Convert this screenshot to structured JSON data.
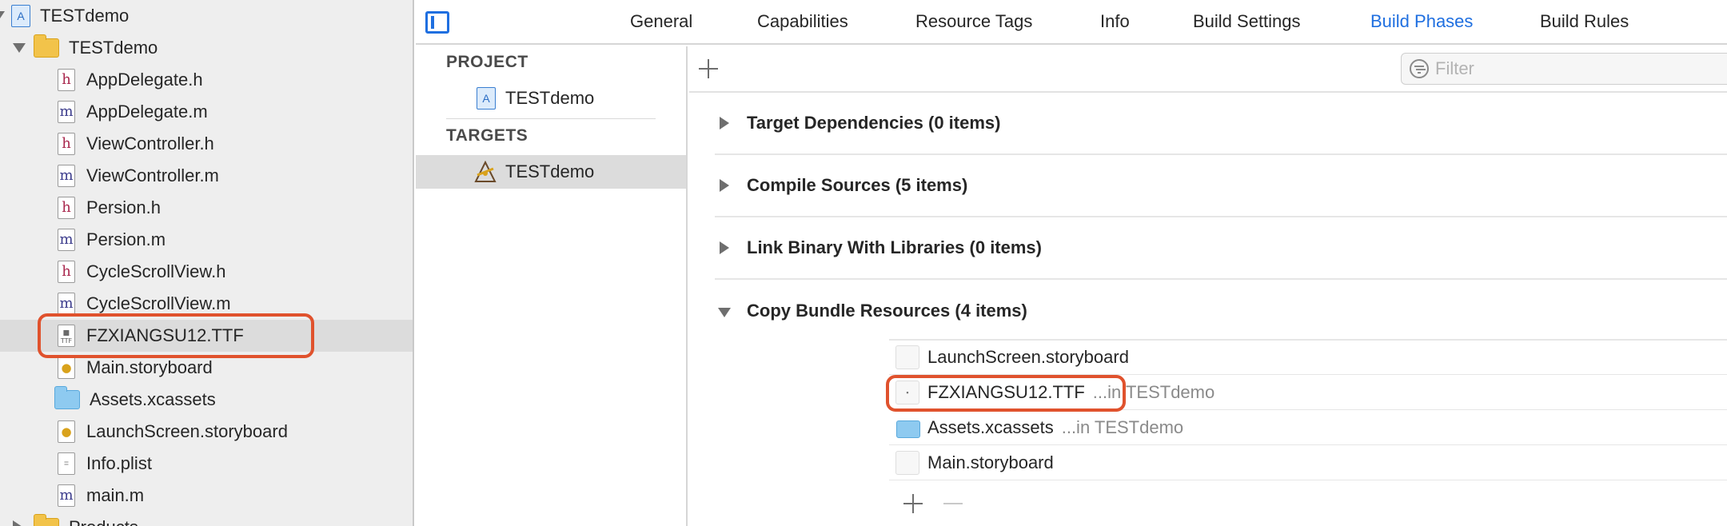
{
  "navigator": {
    "project_name": "TESTdemo",
    "group_name": "TESTdemo",
    "files": [
      {
        "name": "AppDelegate.h",
        "icon": "header-file-icon",
        "glyph": "h"
      },
      {
        "name": "AppDelegate.m",
        "icon": "source-file-icon",
        "glyph": "m"
      },
      {
        "name": "ViewController.h",
        "icon": "header-file-icon",
        "glyph": "h"
      },
      {
        "name": "ViewController.m",
        "icon": "source-file-icon",
        "glyph": "m"
      },
      {
        "name": "Persion.h",
        "icon": "header-file-icon",
        "glyph": "h"
      },
      {
        "name": "Persion.m",
        "icon": "source-file-icon",
        "glyph": "m"
      },
      {
        "name": "CycleScrollView.h",
        "icon": "header-file-icon",
        "glyph": "h"
      },
      {
        "name": "CycleScrollView.m",
        "icon": "source-file-icon",
        "glyph": "m"
      },
      {
        "name": "FZXIANGSU12.TTF",
        "icon": "font-file-icon",
        "glyph": "TTF"
      },
      {
        "name": "Main.storyboard",
        "icon": "storyboard-file-icon"
      },
      {
        "name": "Assets.xcassets",
        "icon": "asset-catalog-icon"
      },
      {
        "name": "LaunchScreen.storyboard",
        "icon": "storyboard-file-icon"
      },
      {
        "name": "Info.plist",
        "icon": "plist-file-icon"
      },
      {
        "name": "main.m",
        "icon": "source-file-icon",
        "glyph": "m"
      }
    ],
    "products_group": "Products",
    "selected_file": "FZXIANGSU12.TTF"
  },
  "tabs": {
    "items": [
      "General",
      "Capabilities",
      "Resource Tags",
      "Info",
      "Build Settings",
      "Build Phases",
      "Build Rules"
    ],
    "active": "Build Phases"
  },
  "targets_pane": {
    "project_header": "PROJECT",
    "project_item": "TESTdemo",
    "targets_header": "TARGETS",
    "target_item": "TESTdemo"
  },
  "phases": {
    "filter_placeholder": "Filter",
    "list": [
      {
        "title": "Target Dependencies (0 items)",
        "expanded": false
      },
      {
        "title": "Compile Sources (5 items)",
        "expanded": false
      },
      {
        "title": "Link Binary With Libraries (0 items)",
        "expanded": false
      },
      {
        "title": "Copy Bundle Resources (4 items)",
        "expanded": true
      }
    ],
    "resources": [
      {
        "name": "LaunchScreen.storyboard",
        "location": ""
      },
      {
        "name": "FZXIANGSU12.TTF",
        "location": "...in TESTdemo"
      },
      {
        "name": "Assets.xcassets",
        "location": "...in TESTdemo"
      },
      {
        "name": "Main.storyboard",
        "location": ""
      }
    ]
  },
  "colors": {
    "accent": "#1f6fe0",
    "highlight": "#e0522d",
    "selection": "#dcdcdc"
  }
}
